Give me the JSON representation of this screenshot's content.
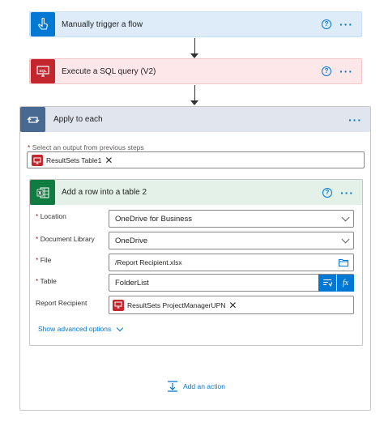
{
  "trigger": {
    "title": "Manually trigger a flow",
    "color": "#0078d4"
  },
  "sql": {
    "title": "Execute a SQL query (V2)",
    "color": "#c4262e"
  },
  "apply": {
    "title": "Apply to each",
    "select_label": "Select an output from previous steps",
    "token": "ResultSets Table1"
  },
  "add_row": {
    "title": "Add a row into a table 2",
    "color": "#107c41",
    "fields": {
      "location": {
        "label": "Location",
        "value": "OneDrive for Business"
      },
      "document_library": {
        "label": "Document Library",
        "value": "OneDrive"
      },
      "file": {
        "label": "File",
        "value": "/Report Recipient.xlsx"
      },
      "table": {
        "label": "Table",
        "value": "FolderList"
      },
      "report_recipient": {
        "label": "Report Recipient",
        "token": "ResultSets ProjectManagerUPN"
      }
    },
    "advanced_link": "Show advanced options",
    "fx_label": "fx"
  },
  "add_action": "Add an action",
  "required_mark": "*"
}
